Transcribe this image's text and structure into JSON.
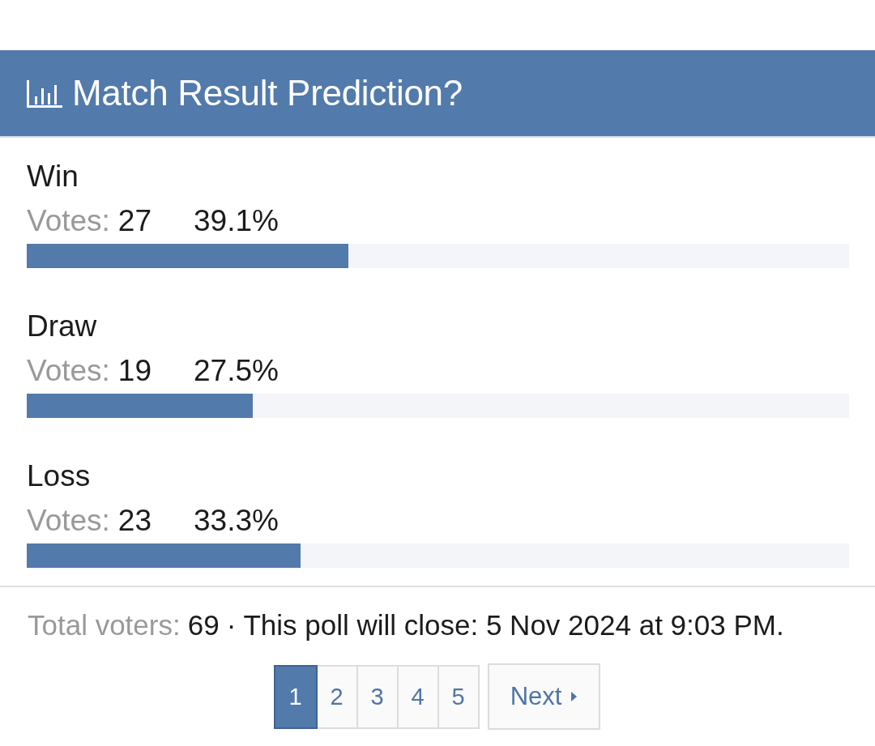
{
  "poll": {
    "title": "Match Result Prediction?",
    "options": [
      {
        "label": "Win",
        "votes_label": "Votes:",
        "votes": "27",
        "percent": "39.1%",
        "level": 0.391
      },
      {
        "label": "Draw",
        "votes_label": "Votes:",
        "votes": "19",
        "percent": "27.5%",
        "level": 0.275
      },
      {
        "label": "Loss",
        "votes_label": "Votes:",
        "votes": "23",
        "percent": "33.3%",
        "level": 0.333
      }
    ]
  },
  "footer": {
    "total_label": "Total voters:",
    "total": "69",
    "close_text": "· This poll will close: 5 Nov 2024 at 9:03 PM."
  },
  "pagination": {
    "pages": [
      {
        "label": "1",
        "selected": true
      },
      {
        "label": "2",
        "selected": false
      },
      {
        "label": "3",
        "selected": false
      },
      {
        "label": "4",
        "selected": false
      },
      {
        "label": "5",
        "selected": false
      }
    ],
    "next": {
      "label": "Next"
    }
  }
}
